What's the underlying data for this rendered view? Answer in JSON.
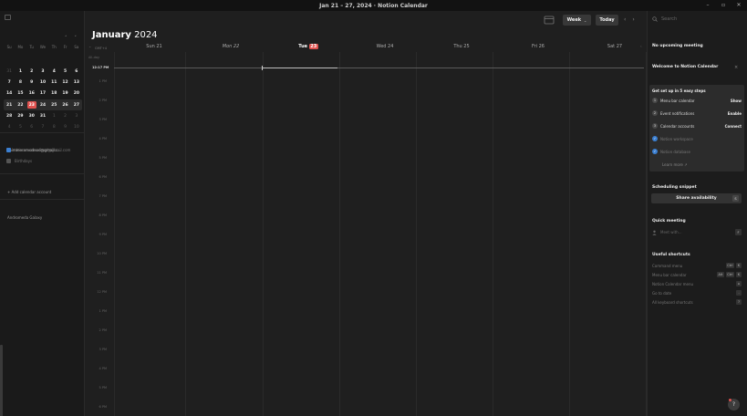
{
  "window": {
    "title": "Jan 21 – 27, 2024 · Notion Calendar",
    "controls": {
      "minimize": "–",
      "maximize": "▫",
      "close": "✕"
    }
  },
  "sidebar": {
    "mini_calendar": {
      "prev": "˄",
      "next": "˅",
      "weekdays": [
        "Su",
        "Mo",
        "Tu",
        "We",
        "Th",
        "Fr",
        "Sa"
      ],
      "weeks": [
        [
          {
            "d": "31",
            "m": true
          },
          {
            "d": "1"
          },
          {
            "d": "2"
          },
          {
            "d": "3"
          },
          {
            "d": "4"
          },
          {
            "d": "5"
          },
          {
            "d": "6"
          }
        ],
        [
          {
            "d": "7"
          },
          {
            "d": "8"
          },
          {
            "d": "9"
          },
          {
            "d": "10"
          },
          {
            "d": "11"
          },
          {
            "d": "12"
          },
          {
            "d": "13"
          }
        ],
        [
          {
            "d": "14"
          },
          {
            "d": "15"
          },
          {
            "d": "16"
          },
          {
            "d": "17"
          },
          {
            "d": "18"
          },
          {
            "d": "19"
          },
          {
            "d": "20"
          }
        ],
        [
          {
            "d": "21"
          },
          {
            "d": "22"
          },
          {
            "d": "23",
            "today": true
          },
          {
            "d": "24"
          },
          {
            "d": "25"
          },
          {
            "d": "26"
          },
          {
            "d": "27"
          }
        ],
        [
          {
            "d": "28"
          },
          {
            "d": "29"
          },
          {
            "d": "30"
          },
          {
            "d": "31"
          },
          {
            "d": "1",
            "m": true
          },
          {
            "d": "2",
            "m": true
          },
          {
            "d": "3",
            "m": true
          }
        ],
        [
          {
            "d": "4",
            "m": true
          },
          {
            "d": "5",
            "m": true
          },
          {
            "d": "6",
            "m": true
          },
          {
            "d": "7",
            "m": true
          },
          {
            "d": "8",
            "m": true
          },
          {
            "d": "9",
            "m": true
          },
          {
            "d": "10",
            "m": true
          }
        ]
      ]
    },
    "account_email": "shimmeramodnod@gmail.c...",
    "calendars": [
      {
        "label": "shimmeramodnod@gmail.com",
        "color": "#3b7fd1"
      },
      {
        "label": "Birthdays",
        "color": "#555555"
      }
    ],
    "add_account": "+ Add calendar account",
    "second_account": "Andromeda Galaxy"
  },
  "header": {
    "month": "January",
    "year": "2024",
    "view": "Week",
    "view_chevron": "⌄",
    "today": "Today",
    "prev": "‹",
    "next": "›"
  },
  "week": {
    "gmt": "GMT+4",
    "all_day": "All-day",
    "now_time": "12:17 PM",
    "days": [
      {
        "label": "Sun 21"
      },
      {
        "label": "Mon 22",
        "italic": true
      },
      {
        "label": "Tue",
        "badge": "23",
        "today": true
      },
      {
        "label": "Wed 24"
      },
      {
        "label": "Thu 25"
      },
      {
        "label": "Fri 26"
      },
      {
        "label": "Sat 27"
      }
    ],
    "hours": [
      "1 PM",
      "2 PM",
      "3 PM",
      "4 PM",
      "5 PM",
      "6 PM",
      "7 PM",
      "8 PM",
      "9 PM",
      "10 PM",
      "11 PM",
      "12 PM",
      "1 PM",
      "2 PM",
      "3 PM",
      "4 PM",
      "5 PM",
      "6 PM"
    ]
  },
  "right_panel": {
    "search_placeholder": "Search",
    "no_upcoming": "No upcoming meeting",
    "welcome": "Welcome to Notion Calendar",
    "close": "×",
    "setup_title": "Get set up in 5 easy steps",
    "steps": [
      {
        "num": "1",
        "label": "Menu bar calendar",
        "action": "Show"
      },
      {
        "num": "2",
        "label": "Event notifications",
        "action": "Enable"
      },
      {
        "num": "3",
        "label": "Calendar accounts",
        "action": "Connect"
      },
      {
        "num": "✓",
        "label": "Notion workspace",
        "done": true
      },
      {
        "num": "✓",
        "label": "Notion database",
        "done": true
      }
    ],
    "learn_more": "Learn more ↗",
    "scheduling_title": "Scheduling snippet",
    "share_label": "Share availability",
    "share_key": "S",
    "quick_meeting_title": "Quick meeting",
    "meet_placeholder": "Meet with...",
    "meet_key": "F",
    "shortcuts_title": "Useful shortcuts",
    "shortcuts": [
      {
        "label": "Command menu",
        "keys": [
          "Ctrl",
          "K"
        ]
      },
      {
        "label": "Menu bar calendar",
        "keys": [
          "Alt",
          "Ctrl",
          "K"
        ]
      },
      {
        "label": "Notion Calendar menu",
        "keys": [
          "⌂"
        ]
      },
      {
        "label": "Go to date",
        "keys": [
          "."
        ]
      },
      {
        "label": "All keyboard shortcuts",
        "keys": [
          "?"
        ]
      }
    ],
    "help": "?"
  }
}
